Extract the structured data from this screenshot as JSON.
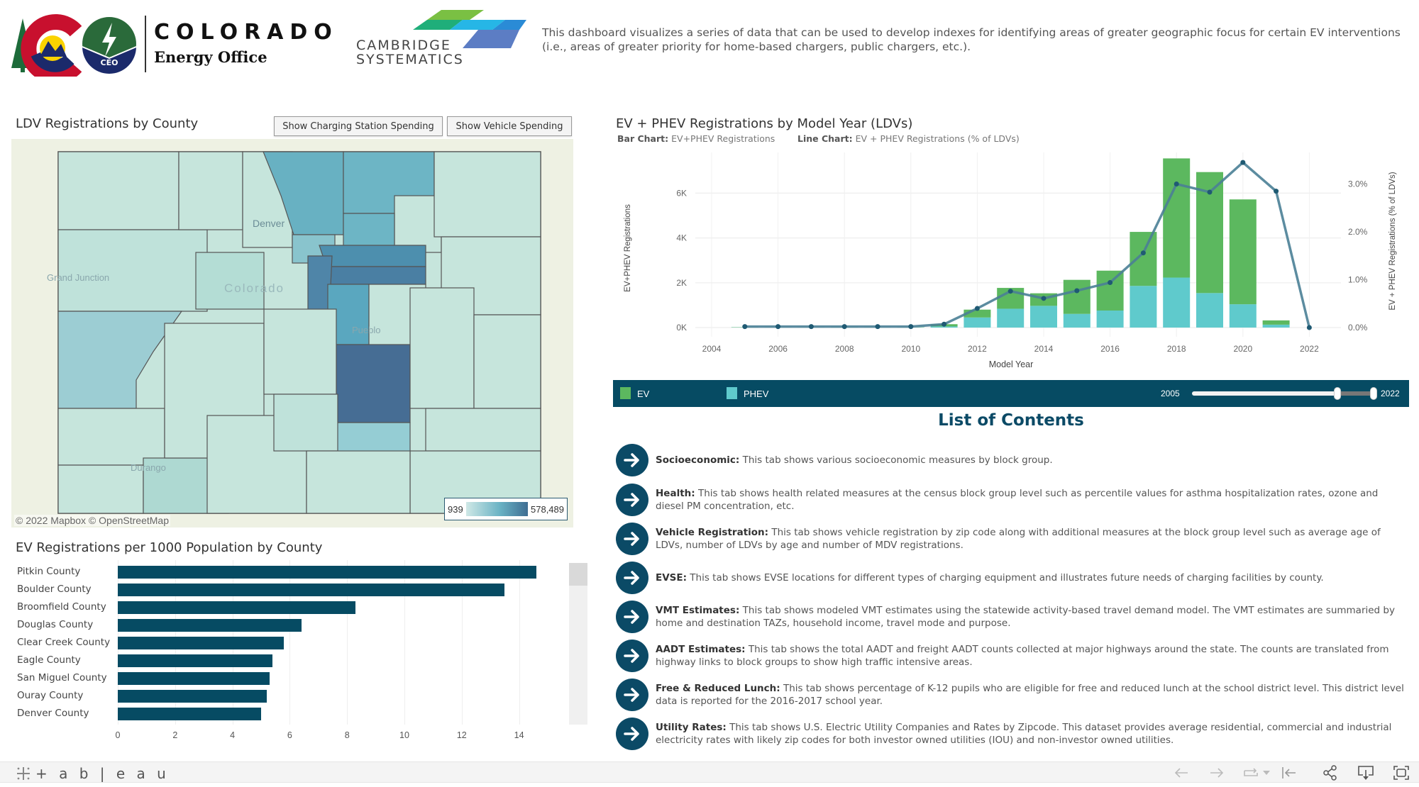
{
  "header": {
    "org_name": "COLORADO",
    "org_sub": "Energy Office",
    "ceo_badge": "CEO",
    "partner_line1": "CAMBRIDGE",
    "partner_line2": "SYSTEMATICS",
    "description": "This dashboard visualizes a series of data that can be used to develop indexes for identifying areas of greater geographic focus for certain EV interventions (i.e., areas of greater priority for home-based chargers, public chargers, etc.)."
  },
  "map_panel": {
    "title": "LDV Registrations by County",
    "buttons": [
      "Show Charging Station Spending",
      "Show Vehicle Spending"
    ],
    "place_labels": [
      "Denver",
      "Colorado",
      "Grand Junction",
      "Pueblo",
      "Durango"
    ],
    "attribution": "© 2022 Mapbox  © OpenStreetMap",
    "legend_min": "939",
    "legend_max": "578,489",
    "colors": {
      "low": "#cfe8e6",
      "mid": "#69b2c4",
      "high": "#3f6d92"
    }
  },
  "ev_per_1000": {
    "title": "EV Registrations per 1000 Population by County",
    "chart_data": {
      "type": "bar",
      "orientation": "horizontal",
      "categories": [
        "Pitkin County",
        "Boulder County",
        "Broomfield County",
        "Douglas County",
        "Clear Creek County",
        "Eagle County",
        "San Miguel County",
        "Ouray County",
        "Denver County"
      ],
      "values": [
        14.6,
        13.5,
        8.3,
        6.4,
        5.8,
        5.4,
        5.3,
        5.2,
        5.0
      ],
      "xlim": [
        0,
        15
      ],
      "xticks": [
        "0",
        "2",
        "4",
        "6",
        "8",
        "10",
        "12",
        "14"
      ],
      "color": "#064b63"
    }
  },
  "model_year_chart": {
    "title": "EV + PHEV Registrations by Model Year (LDVs)",
    "sub_bar_label": "Bar Chart:",
    "sub_bar_value": "EV+PHEV Registrations",
    "sub_line_label": "Line Chart:",
    "sub_line_value": "EV + PHEV Registrations (% of LDVs)",
    "chart_data": {
      "type": "bar",
      "stacked": true,
      "combo_line": true,
      "xlabel": "Model Year",
      "ylabel": "EV+PHEV Registrations",
      "y2label": "EV + PHEV Registrations (% of LDVs)",
      "x": [
        2005,
        2006,
        2007,
        2008,
        2009,
        2010,
        2011,
        2012,
        2013,
        2014,
        2015,
        2016,
        2017,
        2018,
        2019,
        2020,
        2021,
        2022
      ],
      "series": [
        {
          "name": "PHEV",
          "color": "#5fcacc",
          "values": [
            10,
            5,
            5,
            10,
            5,
            10,
            50,
            450,
            840,
            970,
            610,
            760,
            1860,
            2230,
            1540,
            1040,
            130,
            0
          ]
        },
        {
          "name": "EV",
          "color": "#5cb85f",
          "values": [
            10,
            5,
            5,
            10,
            5,
            10,
            100,
            350,
            930,
            560,
            1520,
            1780,
            2410,
            5320,
            5400,
            4680,
            190,
            0
          ]
        }
      ],
      "line": {
        "name": "EV + PHEV Registrations (% of LDVs)",
        "color": "#4a7f96",
        "values": [
          0.02,
          0.02,
          0.02,
          0.02,
          0.02,
          0.02,
          0.07,
          0.4,
          0.76,
          0.61,
          0.77,
          0.94,
          1.56,
          3.0,
          2.83,
          3.45,
          2.85,
          0.0
        ]
      },
      "ylim": [
        0,
        7500
      ],
      "yticks": [
        "0K",
        "2K",
        "4K",
        "6K"
      ],
      "y2lim": [
        0,
        3.6
      ],
      "y2ticks": [
        "0.0%",
        "1.0%",
        "2.0%",
        "3.0%"
      ],
      "xticks": [
        "2004",
        "2006",
        "2008",
        "2010",
        "2012",
        "2014",
        "2016",
        "2018",
        "2020",
        "2022"
      ],
      "grid": true
    },
    "legend": {
      "ev": "EV",
      "phev": "PHEV"
    },
    "slider": {
      "min_label": "2005",
      "max_label": "2022",
      "range_start_fraction": 0.8,
      "range_end_fraction": 1.0
    }
  },
  "contents": {
    "title": "List of Contents",
    "items": [
      {
        "name": "Socioeconomic:",
        "desc": " This tab shows various socioeconomic measures by block group."
      },
      {
        "name": "Health:",
        "desc": " This tab shows health related measures at the census block group level such as percentile values for asthma hospitalization rates, ozone and diesel PM concentration, etc."
      },
      {
        "name": "Vehicle Registration:",
        "desc": " This tab shows vehicle registration by zip code along with additional measures at the block group level such as average age of LDVs, number of LDVs by age and number of MDV registrations."
      },
      {
        "name": "EVSE:",
        "desc": " This tab shows EVSE locations for different types of charging equipment and illustrates future needs of charging facilities by county."
      },
      {
        "name": "VMT Estimates:",
        "desc": " This tab shows modeled VMT estimates using the statewide activity-based travel demand model. The VMT estimates are summaried by home and destination TAZs, household income, travel mode and purpose."
      },
      {
        "name": "AADT Estimates:",
        "desc": " This tab shows the total AADT and freight AADT counts collected at major highways around the state. The counts are translated from highway links to block groups to show high traffic intensive areas."
      },
      {
        "name": "Free & Reduced Lunch:",
        "desc": " This tab shows percentage of K-12 pupils who are eligible for free and reduced lunch at the school district level. This district level data is reported for the 2016-2017 school year."
      },
      {
        "name": "Utility Rates:",
        "desc": " This tab shows U.S. Electric Utility Companies and Rates by Zipcode. This dataset provides average residential, commercial and industrial electricity rates with likely zip codes for both investor owned utilities (IOU) and non-investor owned utilities."
      }
    ]
  },
  "toolbar": {
    "brand": "+ a b | e a u",
    "icons": [
      "undo-icon",
      "redo-icon",
      "revert-icon",
      "dropdown-icon",
      "reset-icon",
      "share-icon",
      "download-icon",
      "fullscreen-icon"
    ]
  }
}
